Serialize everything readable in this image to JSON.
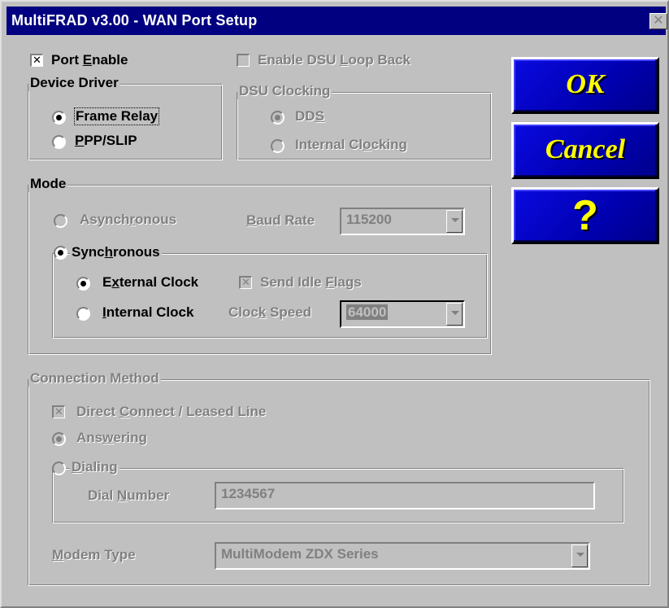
{
  "window": {
    "title": "MultiFRAD v3.00 - WAN Port Setup",
    "close_glyph": "✕"
  },
  "port_enable": {
    "label_pre": "Port ",
    "accel": "E",
    "label_post": "nable",
    "checked": true
  },
  "dsu_loopback": {
    "label_pre": "Enable DSU ",
    "accel": "L",
    "label_post": "oop Back"
  },
  "device_driver": {
    "legend": "Device Driver",
    "frame_relay": "Frame Relay",
    "ppp_pre": "",
    "ppp_accel": "P",
    "ppp_post": "PP/SLIP"
  },
  "dsu_clocking": {
    "legend": "DSU Clocking",
    "dds_pre": "DD",
    "dds_accel": "S",
    "internal_pre": "Internal Cl",
    "internal_accel": "o",
    "internal_post": "cking"
  },
  "mode": {
    "legend": "Mode",
    "async_pre": "Asynch",
    "async_accel": "r",
    "async_post": "onous",
    "baud_accel": "B",
    "baud_post": "aud Rate",
    "baud_value": "115200",
    "sync_pre": "Sync",
    "sync_accel": "h",
    "sync_post": "ronous",
    "ext_pre": "E",
    "ext_accel": "x",
    "ext_post": "ternal Clock",
    "idle_pre": "Send Idle ",
    "idle_accel": "F",
    "idle_post": "lags",
    "int_accel": "I",
    "int_post": "nternal Clock",
    "speed_pre": "Cloc",
    "speed_accel": "k",
    "speed_post": " Speed",
    "speed_value": "64000"
  },
  "connection": {
    "legend": "Connection Method",
    "direct_pre": "Direct ",
    "direct_accel": "C",
    "direct_post": "onnect / Leased Line",
    "ans_pre": "Ans",
    "ans_accel": "w",
    "ans_post": "ering",
    "dial_accel": "D",
    "dial_post": "ialing",
    "dialnum_pre": "Dial ",
    "dialnum_accel": "N",
    "dialnum_post": "umber",
    "dial_value": "1234567",
    "modem_accel": "M",
    "modem_post": "odem Type",
    "modem_value": "MultiModem ZDX Series"
  },
  "buttons": {
    "ok": "OK",
    "cancel": "Cancel",
    "help": "?"
  }
}
